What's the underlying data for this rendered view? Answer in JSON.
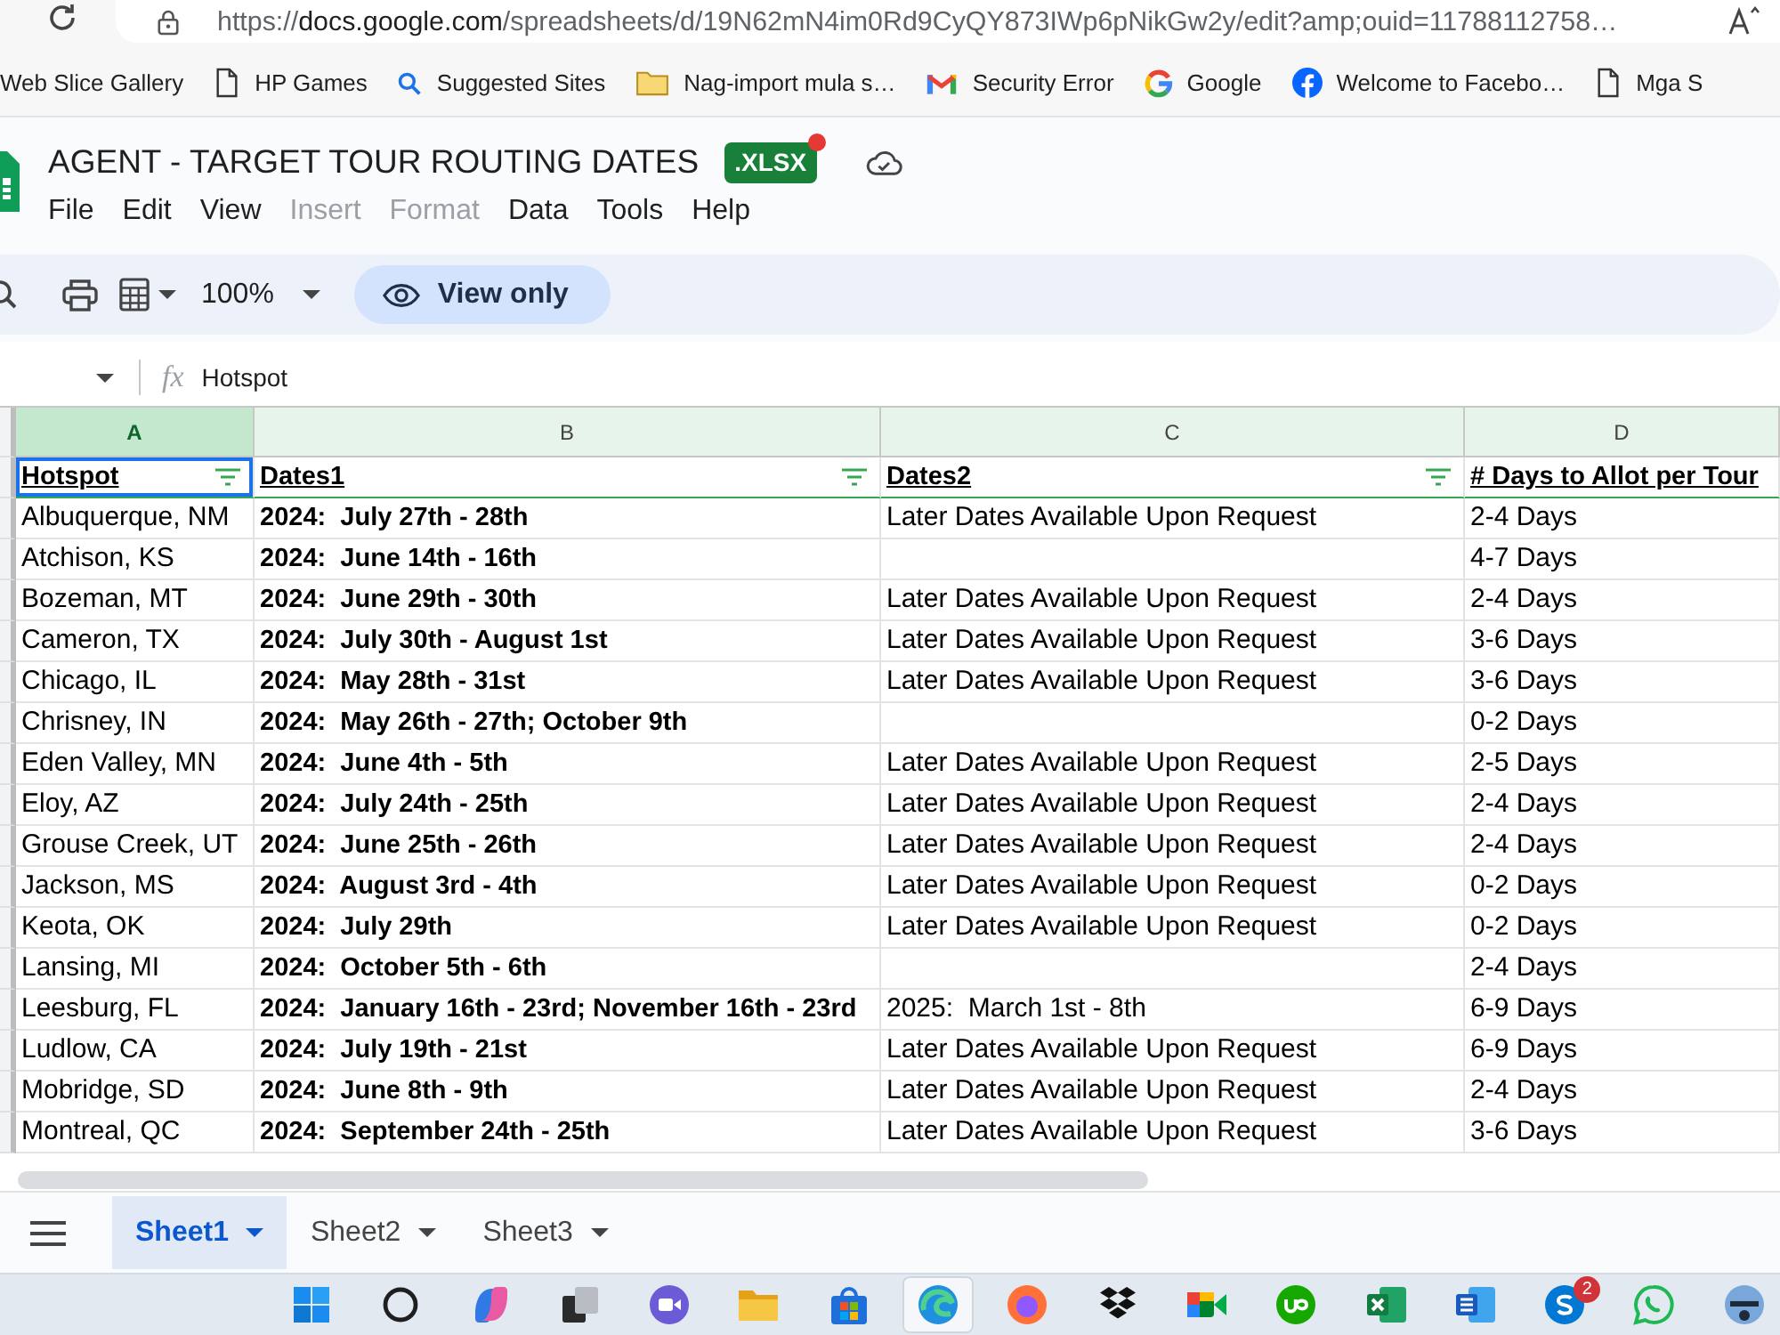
{
  "browser": {
    "url": {
      "scheme": "https://",
      "host": "docs.google.com",
      "path": "/spreadsheets/d/19N62mN4im0Rd9CyQY873IWp6pNikGw2y/edit?amp;ouid=11788112758…"
    },
    "bookmarks": [
      {
        "label": "Web Slice Gallery",
        "kind": "plain"
      },
      {
        "label": "HP Games",
        "kind": "page"
      },
      {
        "label": "Suggested Sites",
        "kind": "search"
      },
      {
        "label": "Nag-import mula s…",
        "kind": "folder"
      },
      {
        "label": "Security Error",
        "kind": "mail"
      },
      {
        "label": "Google",
        "kind": "google"
      },
      {
        "label": "Welcome to Facebo…",
        "kind": "facebook"
      },
      {
        "label": "Mga S",
        "kind": "page"
      }
    ]
  },
  "document": {
    "title": "AGENT - TARGET TOUR ROUTING DATES",
    "file_type": ".XLSX",
    "menu": [
      {
        "label": "File",
        "disabled": false
      },
      {
        "label": "Edit",
        "disabled": false
      },
      {
        "label": "View",
        "disabled": false
      },
      {
        "label": "Insert",
        "disabled": true
      },
      {
        "label": "Format",
        "disabled": true
      },
      {
        "label": "Data",
        "disabled": false
      },
      {
        "label": "Tools",
        "disabled": false
      },
      {
        "label": "Help",
        "disabled": false
      }
    ]
  },
  "toolbar": {
    "zoom": "100%",
    "mode": "View only"
  },
  "formula_bar": {
    "function_label": "fx",
    "value": "Hotspot"
  },
  "sheet": {
    "columns": [
      {
        "label": "A",
        "selected": true
      },
      {
        "label": "B",
        "selected": false
      },
      {
        "label": "C",
        "selected": false
      },
      {
        "label": "D",
        "selected": false
      }
    ],
    "header_row": [
      {
        "text": "Hotspot",
        "filter": true,
        "selected": true
      },
      {
        "text": "Dates1",
        "filter": true,
        "selected": false
      },
      {
        "text": "Dates2",
        "filter": true,
        "selected": false
      },
      {
        "text": "# Days to Allot per Tour",
        "filter": false,
        "selected": false
      }
    ],
    "rows": [
      {
        "hotspot": "Albuquerque, NM",
        "dates1": "2024:  July 27th - 28th",
        "dates2": "Later Dates Available Upon Request",
        "days_to_allot": "2-4 Days"
      },
      {
        "hotspot": "Atchison, KS",
        "dates1": "2024:  June 14th - 16th",
        "days_to_allot": "4-7 Days"
      },
      {
        "hotspot": "Bozeman, MT",
        "dates1": "2024:  June 29th - 30th",
        "dates2": "Later Dates Available Upon Request",
        "days_to_allot": "2-4 Days"
      },
      {
        "hotspot": "Cameron, TX",
        "dates1": "2024:  July 30th - August 1st",
        "dates2": "Later Dates Available Upon Request",
        "days_to_allot": "3-6 Days"
      },
      {
        "hotspot": "Chicago, IL",
        "dates1": "2024:  May 28th - 31st",
        "dates2": "Later Dates Available Upon Request",
        "days_to_allot": "3-6 Days"
      },
      {
        "hotspot": "Chrisney, IN",
        "dates1": "2024:  May 26th - 27th; October 9th",
        "days_to_allot": "0-2 Days"
      },
      {
        "hotspot": "Eden Valley, MN",
        "dates1": "2024:  June 4th - 5th",
        "dates2": "Later Dates Available Upon Request",
        "days_to_allot": "2-5 Days"
      },
      {
        "hotspot": "Eloy, AZ",
        "dates1": "2024:  July 24th - 25th",
        "dates2": "Later Dates Available Upon Request",
        "days_to_allot": "2-4 Days"
      },
      {
        "hotspot": "Grouse Creek, UT",
        "dates1": "2024:  June 25th - 26th",
        "dates2": "Later Dates Available Upon Request",
        "days_to_allot": "2-4 Days"
      },
      {
        "hotspot": "Jackson, MS",
        "dates1": "2024:  August 3rd - 4th",
        "dates2": "Later Dates Available Upon Request",
        "days_to_allot": "0-2 Days"
      },
      {
        "hotspot": "Keota, OK",
        "dates1": "2024:  July 29th",
        "dates2": "Later Dates Available Upon Request",
        "days_to_allot": "0-2 Days"
      },
      {
        "hotspot": "Lansing, MI",
        "dates1": "2024:  October 5th - 6th",
        "days_to_allot": "2-4 Days"
      },
      {
        "hotspot": "Leesburg, FL",
        "dates1": "2024:  January 16th - 23rd; November 16th - 23rd",
        "dates2": "2025:  March 1st - 8th",
        "days_to_allot": "6-9 Days"
      },
      {
        "hotspot": "Ludlow, CA",
        "dates1": "2024:  July 19th - 21st",
        "dates2": "Later Dates Available Upon Request",
        "days_to_allot": "6-9 Days"
      },
      {
        "hotspot": "Mobridge, SD",
        "dates1": "2024:  June 8th - 9th",
        "dates2": "Later Dates Available Upon Request",
        "days_to_allot": "2-4 Days"
      },
      {
        "hotspot": "Montreal, QC",
        "dates1": "2024:  September 24th - 25th",
        "dates2": "Later Dates Available Upon Request",
        "days_to_allot": "3-6 Days"
      }
    ]
  },
  "sheet_tabs": [
    {
      "label": "Sheet1",
      "selected": true
    },
    {
      "label": "Sheet2",
      "selected": false
    },
    {
      "label": "Sheet3",
      "selected": false
    }
  ],
  "taskbar": {
    "apps": [
      {
        "kind": "start",
        "selected": false
      },
      {
        "kind": "search",
        "selected": false
      },
      {
        "kind": "copilot",
        "selected": false
      },
      {
        "kind": "taskview",
        "selected": false
      },
      {
        "kind": "teams",
        "selected": false
      },
      {
        "kind": "explorer",
        "selected": false
      },
      {
        "kind": "store",
        "selected": false
      },
      {
        "kind": "edge",
        "selected": true
      },
      {
        "kind": "firefox",
        "selected": false
      },
      {
        "kind": "dropbox",
        "selected": false
      },
      {
        "kind": "meet",
        "selected": false
      },
      {
        "kind": "upwork",
        "selected": false
      },
      {
        "kind": "excel",
        "selected": false
      },
      {
        "kind": "word",
        "selected": false
      },
      {
        "kind": "skype",
        "selected": false,
        "badge": "2"
      },
      {
        "kind": "whatsapp",
        "selected": false
      },
      {
        "kind": "app",
        "selected": false
      }
    ]
  }
}
